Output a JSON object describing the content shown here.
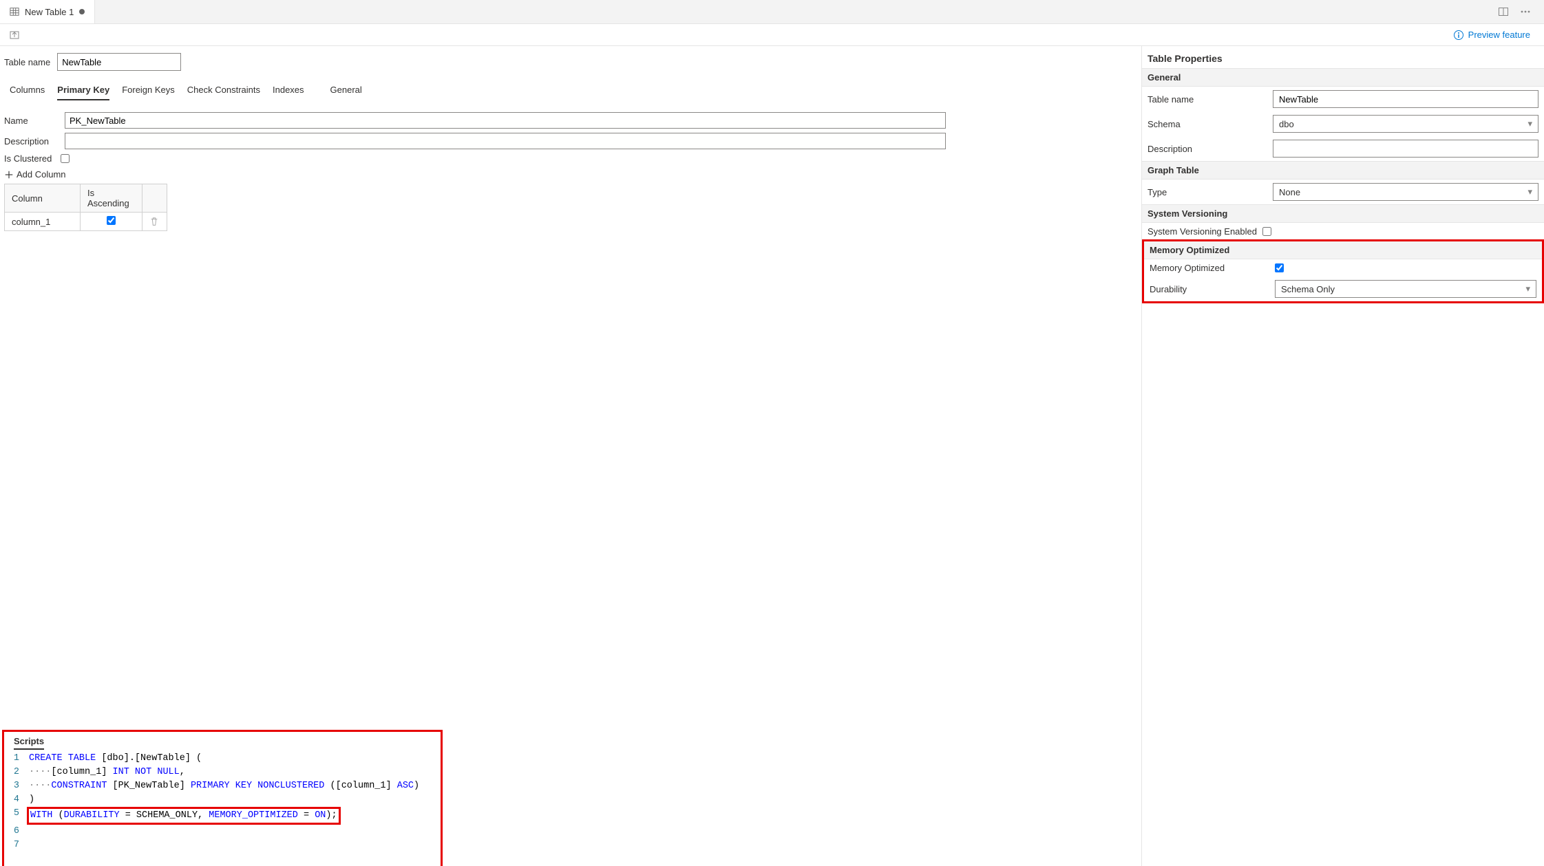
{
  "tab": {
    "title": "New Table 1"
  },
  "header": {
    "preview": "Preview feature"
  },
  "tableName": {
    "label": "Table name",
    "value": "NewTable"
  },
  "subtabs": [
    "Columns",
    "Primary Key",
    "Foreign Keys",
    "Check Constraints",
    "Indexes",
    "General"
  ],
  "activeSubtab": 1,
  "pk": {
    "nameLabel": "Name",
    "name": "PK_NewTable",
    "descLabel": "Description",
    "desc": "",
    "clusteredLabel": "Is Clustered",
    "clustered": false,
    "addColumn": "Add Column",
    "columns": {
      "headers": [
        "Column",
        "Is Ascending",
        ""
      ],
      "rows": [
        {
          "col": "column_1",
          "asc": true
        }
      ]
    }
  },
  "scripts": {
    "title": "Scripts",
    "lines": [
      {
        "n": 1,
        "segs": [
          {
            "t": "CREATE TABLE",
            "c": "kw"
          },
          {
            "t": " [dbo].[NewTable] (",
            "c": "plain"
          }
        ]
      },
      {
        "n": 2,
        "segs": [
          {
            "t": "····",
            "c": "gray"
          },
          {
            "t": "[column_1] ",
            "c": "plain"
          },
          {
            "t": "INT NOT NULL",
            "c": "kw"
          },
          {
            "t": ",",
            "c": "plain"
          }
        ]
      },
      {
        "n": 3,
        "segs": [
          {
            "t": "····",
            "c": "gray"
          },
          {
            "t": "CONSTRAINT",
            "c": "kw"
          },
          {
            "t": " [PK_NewTable] ",
            "c": "plain"
          },
          {
            "t": "PRIMARY KEY NONCLUSTERED",
            "c": "kw"
          },
          {
            "t": " ([column_1] ",
            "c": "plain"
          },
          {
            "t": "ASC",
            "c": "kw"
          },
          {
            "t": ")",
            "c": "plain"
          }
        ]
      },
      {
        "n": 4,
        "segs": [
          {
            "t": ")",
            "c": "plain"
          }
        ]
      },
      {
        "n": 5,
        "hl": true,
        "segs": [
          {
            "t": "WITH",
            "c": "kw"
          },
          {
            "t": " (",
            "c": "plain"
          },
          {
            "t": "DURABILITY",
            "c": "kw"
          },
          {
            "t": " = SCHEMA_ONLY, ",
            "c": "plain"
          },
          {
            "t": "MEMORY_OPTIMIZED",
            "c": "kw"
          },
          {
            "t": " = ",
            "c": "plain"
          },
          {
            "t": "ON",
            "c": "kw"
          },
          {
            "t": ");",
            "c": "plain"
          }
        ]
      },
      {
        "n": 6,
        "segs": []
      },
      {
        "n": 7,
        "segs": []
      }
    ]
  },
  "props": {
    "title": "Table Properties",
    "general": {
      "head": "General",
      "tableNameLabel": "Table name",
      "tableName": "NewTable",
      "schemaLabel": "Schema",
      "schema": "dbo",
      "descLabel": "Description",
      "desc": ""
    },
    "graph": {
      "head": "Graph Table",
      "typeLabel": "Type",
      "type": "None"
    },
    "versioning": {
      "head": "System Versioning",
      "enabledLabel": "System Versioning Enabled",
      "enabled": false
    },
    "memory": {
      "head": "Memory Optimized",
      "optLabel": "Memory Optimized",
      "opt": true,
      "durLabel": "Durability",
      "dur": "Schema Only"
    }
  }
}
